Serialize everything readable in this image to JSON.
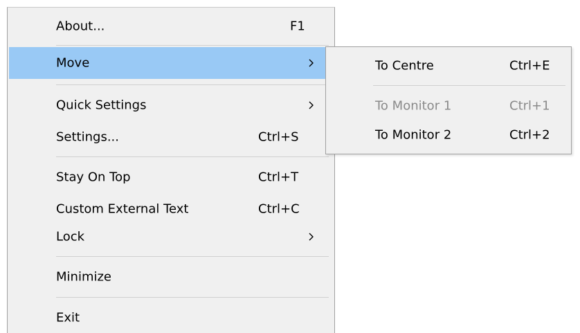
{
  "menu": {
    "items": [
      {
        "label": "About...",
        "shortcut": "F1"
      },
      {
        "label": "Move",
        "submenu": true
      },
      {
        "label": "Quick Settings",
        "submenu": true
      },
      {
        "label": "Settings...",
        "shortcut": "Ctrl+S"
      },
      {
        "label": "Stay On Top",
        "shortcut": "Ctrl+T"
      },
      {
        "label": "Custom External Text",
        "shortcut": "Ctrl+C"
      },
      {
        "label": "Lock",
        "submenu": true
      },
      {
        "label": "Minimize"
      },
      {
        "label": "Exit"
      }
    ]
  },
  "submenu": {
    "items": [
      {
        "label": "To Centre",
        "shortcut": "Ctrl+E",
        "enabled": true
      },
      {
        "label": "To Monitor 1",
        "shortcut": "Ctrl+1",
        "enabled": false
      },
      {
        "label": "To Monitor 2",
        "shortcut": "Ctrl+2",
        "enabled": true
      }
    ]
  },
  "colors": {
    "menu_bg": "#f0f0f0",
    "highlight": "#99c9f5",
    "disabled_text": "#8a8a8a",
    "separator": "#d0d0d0",
    "border": "#a0a0a0"
  },
  "icons": {
    "submenu_arrow": "chevron-right-icon"
  }
}
